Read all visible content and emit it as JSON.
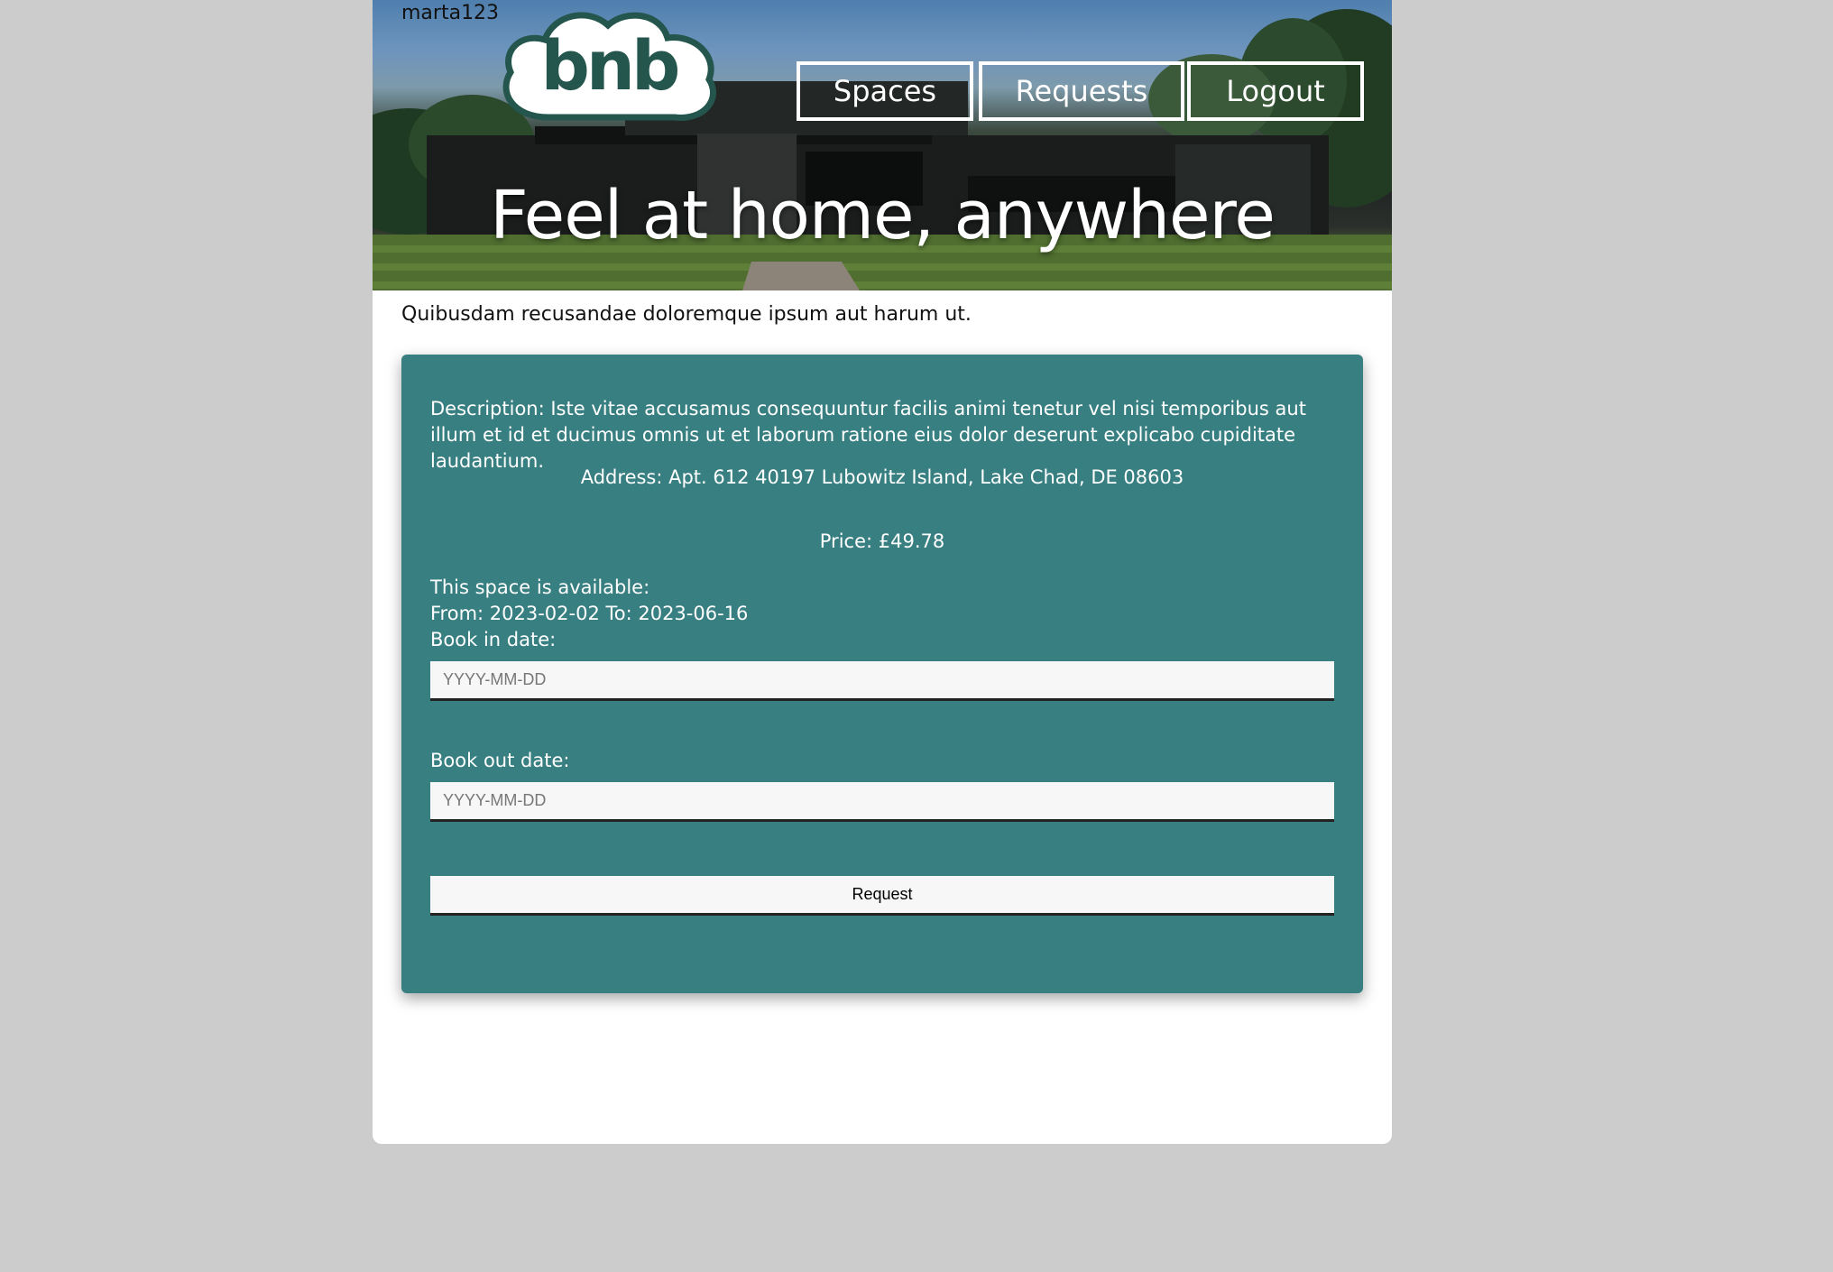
{
  "header": {
    "username": "marta123",
    "logo_text": "bnb",
    "nav": {
      "spaces_label": "Spaces",
      "requests_label": "Requests",
      "logout_label": "Logout"
    },
    "hero_title": "Feel at home, anywhere"
  },
  "space": {
    "name": "Quibusdam recusandae doloremque ipsum aut harum ut.",
    "description": "Description: Iste vitae accusamus consequuntur facilis animi tenetur vel nisi temporibus aut illum et id et ducimus omnis ut et laborum ratione eius dolor deserunt explicabo cupiditate laudantium.",
    "address": "Address: Apt. 612 40197 Lubowitz Island, Lake Chad, DE 08603",
    "price": "Price: £49.78",
    "availability_heading": "This space is available:",
    "availability_range": "From: 2023-02-02 To: 2023-06-16"
  },
  "form": {
    "book_in_label": "Book in date:",
    "book_in_placeholder": "YYYY-MM-DD",
    "book_out_label": "Book out date:",
    "book_out_placeholder": "YYYY-MM-DD",
    "submit_label": "Request"
  },
  "colors": {
    "background": "#cccccc",
    "card": "#387f82",
    "logo": "#24564e",
    "page": "#ffffff"
  }
}
